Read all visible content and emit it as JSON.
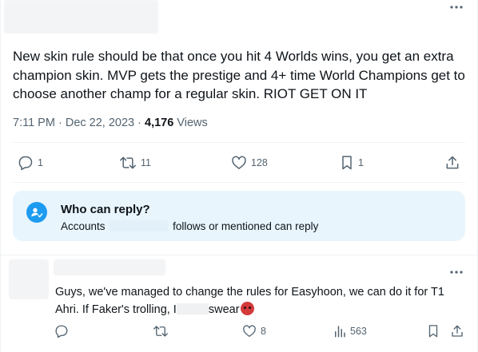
{
  "tweet": {
    "more_label": "···",
    "text": "New skin rule should be that once you hit 4 Worlds wins, you get an extra champion skin. MVP gets the prestige and 4+ time World Champions get to choose another champ for a regular skin. RIOT GET ON IT",
    "time": "7:11 PM",
    "separator": "·",
    "date": "Dec 22, 2023",
    "views_count": "4,176",
    "views_label": "Views",
    "actions": {
      "replies": "1",
      "reposts": "11",
      "likes": "128",
      "bookmarks": "1"
    },
    "icons": [
      "reply-icon",
      "repost-icon",
      "like-icon",
      "bookmark-icon",
      "share-icon"
    ]
  },
  "who_can_reply": {
    "title": "Who can reply?",
    "prefix": "Accounts",
    "suffix": "follows or mentioned can reply",
    "icon": "person-check-icon",
    "accent": "#1d9bf0",
    "background": "#e8f5fd"
  },
  "reply": {
    "more_label": "···",
    "text_part1": "Guys, we've managed to change the rules for Easyhoon, we can do it for T1 Ahri. If Faker's trolling, I",
    "text_part2": "swear",
    "emoji": "angry-face-emoji",
    "actions": {
      "likes": "8",
      "views": "563"
    }
  }
}
